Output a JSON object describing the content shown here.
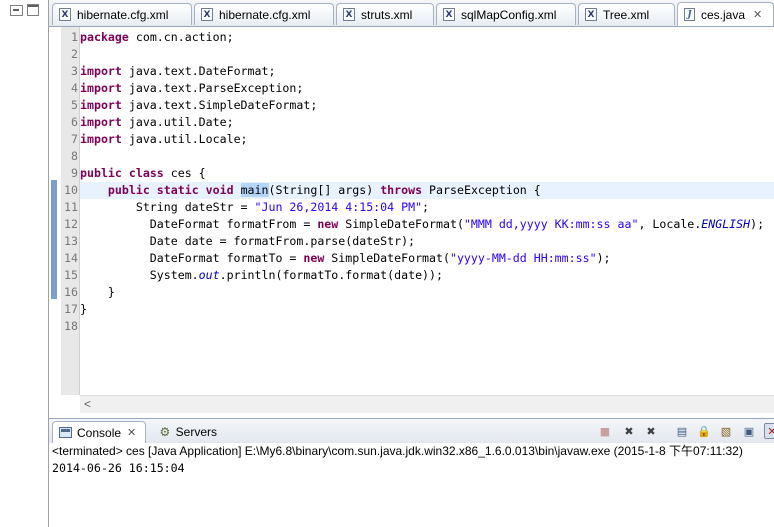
{
  "editor_tabs": [
    {
      "label": "hibernate.cfg.xml",
      "icon": "xml-file-icon",
      "active": false
    },
    {
      "label": "hibernate.cfg.xml",
      "icon": "xml-file-icon",
      "active": false
    },
    {
      "label": "struts.xml",
      "icon": "xml-file-icon",
      "active": false
    },
    {
      "label": "sqlMapConfig.xml",
      "icon": "xml-file-icon",
      "active": false
    },
    {
      "label": "Tree.xml",
      "icon": "xml-file-icon",
      "active": false
    },
    {
      "label": "ces.java",
      "icon": "java-file-icon",
      "active": true,
      "close": "✕"
    }
  ],
  "editor": {
    "line_numbers": [
      "1",
      "2",
      "3",
      "4",
      "5",
      "6",
      "7",
      "8",
      "9",
      "10",
      "11",
      "12",
      "13",
      "14",
      "15",
      "16",
      "17",
      "18"
    ],
    "current_line": "10",
    "selected_text": "main",
    "lines": [
      [
        {
          "t": "package",
          "c": "kw"
        },
        {
          "t": " com.cn.action;"
        }
      ],
      [],
      [
        {
          "t": "import",
          "c": "kw"
        },
        {
          "t": " java.text.DateFormat;"
        }
      ],
      [
        {
          "t": "import",
          "c": "kw"
        },
        {
          "t": " java.text.ParseException;"
        }
      ],
      [
        {
          "t": "import",
          "c": "kw"
        },
        {
          "t": " java.text.SimpleDateFormat;"
        }
      ],
      [
        {
          "t": "import",
          "c": "kw"
        },
        {
          "t": " java.util.Date;"
        }
      ],
      [
        {
          "t": "import",
          "c": "kw"
        },
        {
          "t": " java.util.Locale;"
        }
      ],
      [],
      [
        {
          "t": "public",
          "c": "kw"
        },
        {
          "t": " "
        },
        {
          "t": "class",
          "c": "kw"
        },
        {
          "t": " ces {"
        }
      ],
      [
        {
          "t": "    "
        },
        {
          "t": "public",
          "c": "kw"
        },
        {
          "t": " "
        },
        {
          "t": "static",
          "c": "kw"
        },
        {
          "t": " "
        },
        {
          "t": "void",
          "c": "kw"
        },
        {
          "t": " "
        },
        {
          "t": "main",
          "c": "sel"
        },
        {
          "t": "(String[] args) "
        },
        {
          "t": "throws",
          "c": "kw"
        },
        {
          "t": " ParseException {"
        }
      ],
      [
        {
          "t": "        String dateStr = "
        },
        {
          "t": "\"Jun 26,2014 4:15:04 PM\"",
          "c": "str"
        },
        {
          "t": ";"
        }
      ],
      [
        {
          "t": "          DateFormat formatFrom = "
        },
        {
          "t": "new",
          "c": "kw"
        },
        {
          "t": " SimpleDateFormat("
        },
        {
          "t": "\"MMM dd,yyyy KK:mm:ss aa\"",
          "c": "str"
        },
        {
          "t": ", Locale."
        },
        {
          "t": "ENGLISH",
          "c": "fld"
        },
        {
          "t": ");"
        }
      ],
      [
        {
          "t": "          Date date = formatFrom.parse(dateStr);"
        }
      ],
      [
        {
          "t": "          DateFormat formatTo = "
        },
        {
          "t": "new",
          "c": "kw"
        },
        {
          "t": " SimpleDateFormat("
        },
        {
          "t": "\"yyyy-MM-dd HH:mm:ss\"",
          "c": "str"
        },
        {
          "t": ");"
        }
      ],
      [
        {
          "t": "          System."
        },
        {
          "t": "out",
          "c": "fld"
        },
        {
          "t": ".println(formatTo.format(date));"
        }
      ],
      [
        {
          "t": "    }"
        }
      ],
      [
        {
          "t": "}"
        }
      ],
      []
    ],
    "hscroll_left": "<"
  },
  "console": {
    "tabs": [
      {
        "label": "Console",
        "close": "✕",
        "active": true
      },
      {
        "label": "Servers",
        "active": false
      }
    ],
    "status": "<terminated> ces [Java Application] E:\\My6.8\\binary\\com.sun.java.jdk.win32.x86_1.6.0.013\\bin\\javaw.exe (2015-1-8 下午07:11:32)",
    "output": "2014-06-26 16:15:04"
  },
  "colors": {
    "keyword": "#7f0055",
    "string": "#2a00ff",
    "field": "#0000c0",
    "selection": "#b4d5fe",
    "current_line": "#e8f2fe"
  }
}
